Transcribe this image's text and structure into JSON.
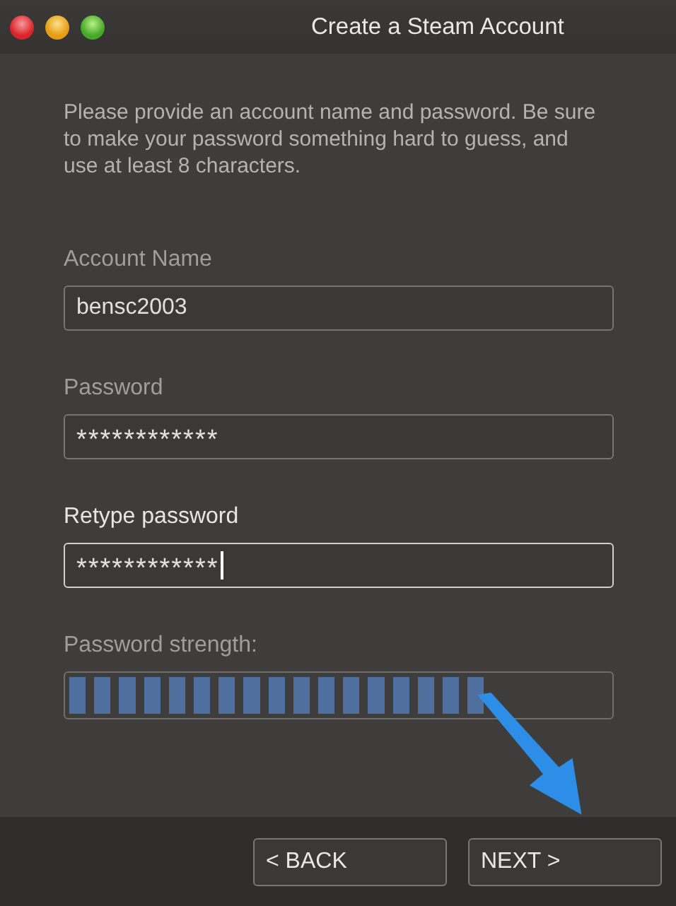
{
  "window": {
    "title": "Create a Steam Account"
  },
  "intro": "Please provide an account name and password. Be sure to make your password something hard to guess, and use at least 8 characters.",
  "fields": [
    {
      "label": "Account Name",
      "value": "bensc2003",
      "focused": false
    },
    {
      "label": "Password",
      "value": "************",
      "focused": false
    },
    {
      "label": "Retype password",
      "value": "************",
      "focused": true
    }
  ],
  "strength": {
    "label": "Password strength:",
    "level": 0.77
  },
  "buttons": [
    "< BACK",
    "NEXT >"
  ]
}
